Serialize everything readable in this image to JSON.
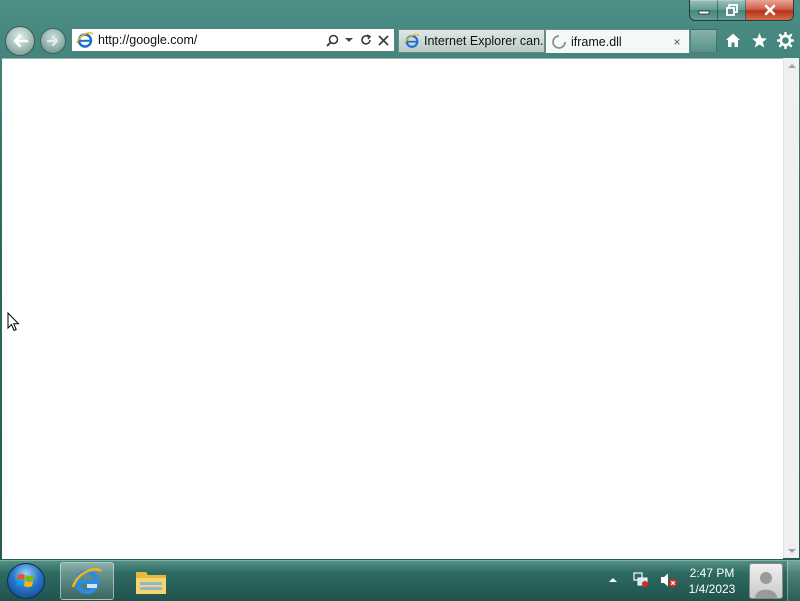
{
  "window": {
    "caption": {
      "minimize_icon": "minimize-icon",
      "restore_icon": "restore-icon",
      "close_icon": "close-icon"
    }
  },
  "nav": {
    "back_icon": "back-arrow-icon",
    "forward_icon": "forward-arrow-icon",
    "address": {
      "value": "http://google.com/",
      "site_icon": "ie-page-icon",
      "tools": [
        "search-icon",
        "dropdown-icon",
        "refresh-icon",
        "stop-icon"
      ]
    },
    "tabs": [
      {
        "title": "Internet Explorer can...",
        "icon": "ie-page-icon",
        "active": false
      },
      {
        "title": "iframe.dll",
        "icon": "loading-spinner-icon",
        "active": true,
        "close": "×"
      }
    ],
    "right_tools": [
      "home-icon",
      "favorites-star-icon",
      "settings-gear-icon"
    ]
  },
  "taskbar": {
    "start_icon": "windows-start-orb-icon",
    "pinned": [
      {
        "name": "internet-explorer",
        "icon": "internet-explorer-icon",
        "active": true
      },
      {
        "name": "windows-explorer",
        "icon": "folder-icon",
        "active": false
      }
    ],
    "tray": {
      "icons": [
        "show-hidden-icons-arrow",
        "network-icon",
        "volume-muted-icon"
      ]
    },
    "clock": {
      "time": "2:47 PM",
      "date": "1/4/2023"
    },
    "user_icon": "user-account-icon"
  },
  "colors": {
    "frame_accent": "#2e6b63",
    "taskbar": "#21534d",
    "close_button": "#c8442a",
    "content_bg": "#ffffff"
  }
}
